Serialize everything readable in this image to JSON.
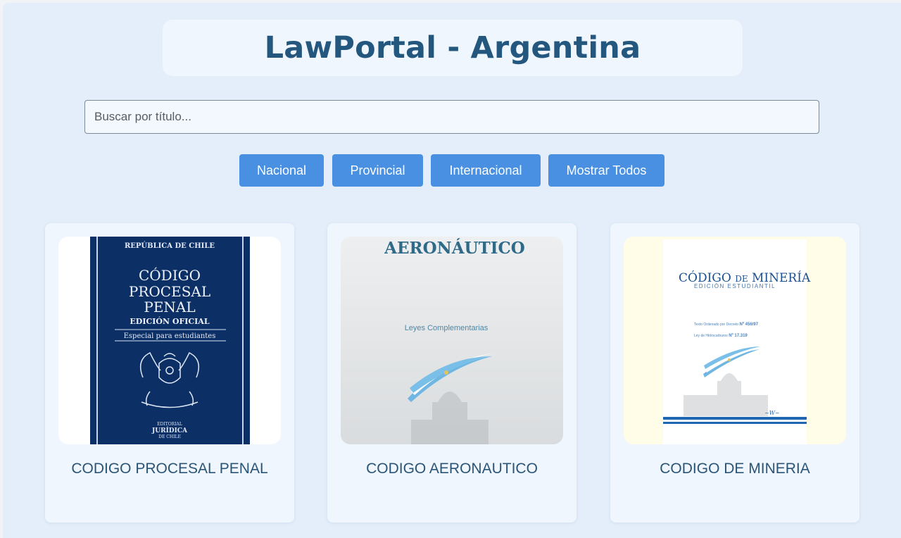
{
  "header": {
    "title": "LawPortal - Argentina"
  },
  "search": {
    "placeholder": "Buscar por título..."
  },
  "filters": [
    "Nacional",
    "Provincial",
    "Internacional",
    "Mostrar Todos"
  ],
  "books": [
    {
      "title": "CODIGO PROCESAL PENAL",
      "cover": {
        "top": "REPÚBLICA DE CHILE",
        "line1": "CÓDIGO",
        "line2": "PROCESAL",
        "line3": "PENAL",
        "edition": "EDICIÓN OFICIAL",
        "note": "Especial para estudiantes",
        "publisher1": "EDITORIAL",
        "publisher2": "JURÍDICA",
        "publisher3": "DE CHILE"
      }
    },
    {
      "title": "CODIGO AERONAUTICO",
      "cover": {
        "heading": "AERONÁUTICO",
        "sub": "Leyes Complementarias"
      }
    },
    {
      "title": "CODIGO DE MINERIA",
      "cover": {
        "heading_a": "CÓDIGO",
        "heading_b": "DE",
        "heading_c": "MINERÍA",
        "sub": "EDICIÓN ESTUDIANTIL",
        "text1": "Texto Ordenado por Decreto",
        "num1": "Nº 456/97",
        "text2": "Ley de Hidrocarburos",
        "num2": "Nº 17.319"
      }
    }
  ],
  "colors": {
    "accent": "#4a90e2",
    "title": "#24577e",
    "navy_cover": "#0c2f66"
  }
}
